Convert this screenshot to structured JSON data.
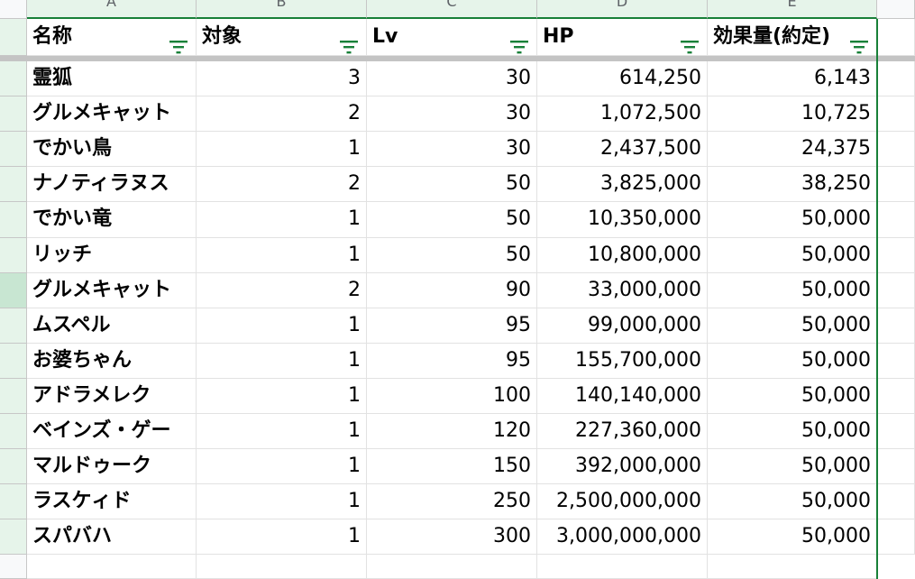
{
  "sheet": {
    "columns": [
      "A",
      "B",
      "C",
      "D",
      "E"
    ],
    "headers": [
      "名称",
      "対象",
      "Lv",
      "HP",
      "効果量(約定)"
    ],
    "rows": [
      {
        "name": "霊狐",
        "target": "3",
        "lv": "30",
        "hp": "614,250",
        "effect": "6,143"
      },
      {
        "name": "グルメキャット",
        "target": "2",
        "lv": "30",
        "hp": "1,072,500",
        "effect": "10,725"
      },
      {
        "name": "でかい鳥",
        "target": "1",
        "lv": "30",
        "hp": "2,437,500",
        "effect": "24,375"
      },
      {
        "name": "ナノティラヌス",
        "target": "2",
        "lv": "50",
        "hp": "3,825,000",
        "effect": "38,250"
      },
      {
        "name": "でかい竜",
        "target": "1",
        "lv": "50",
        "hp": "10,350,000",
        "effect": "50,000"
      },
      {
        "name": "リッチ",
        "target": "1",
        "lv": "50",
        "hp": "10,800,000",
        "effect": "50,000"
      },
      {
        "name": "グルメキャット",
        "target": "2",
        "lv": "90",
        "hp": "33,000,000",
        "effect": "50,000"
      },
      {
        "name": "ムスペル",
        "target": "1",
        "lv": "95",
        "hp": "99,000,000",
        "effect": "50,000"
      },
      {
        "name": "お婆ちゃん",
        "target": "1",
        "lv": "95",
        "hp": "155,700,000",
        "effect": "50,000"
      },
      {
        "name": "アドラメレク",
        "target": "1",
        "lv": "100",
        "hp": "140,140,000",
        "effect": "50,000"
      },
      {
        "name": "ベインズ・ゲー",
        "target": "1",
        "lv": "120",
        "hp": "227,360,000",
        "effect": "50,000"
      },
      {
        "name": "マルドゥーク",
        "target": "1",
        "lv": "150",
        "hp": "392,000,000",
        "effect": "50,000"
      },
      {
        "name": "ラスケィド",
        "target": "1",
        "lv": "250",
        "hp": "2,500,000,000",
        "effect": "50,000"
      },
      {
        "name": "スパバハ",
        "target": "1",
        "lv": "300",
        "hp": "3,000,000,000",
        "effect": "50,000"
      }
    ]
  },
  "icons": {
    "filter": "filter-icon"
  },
  "colors": {
    "filter": "#188038",
    "selection": "#188038",
    "header_selected": "#e6f4ea",
    "row_selected": "#c8e6d2"
  }
}
